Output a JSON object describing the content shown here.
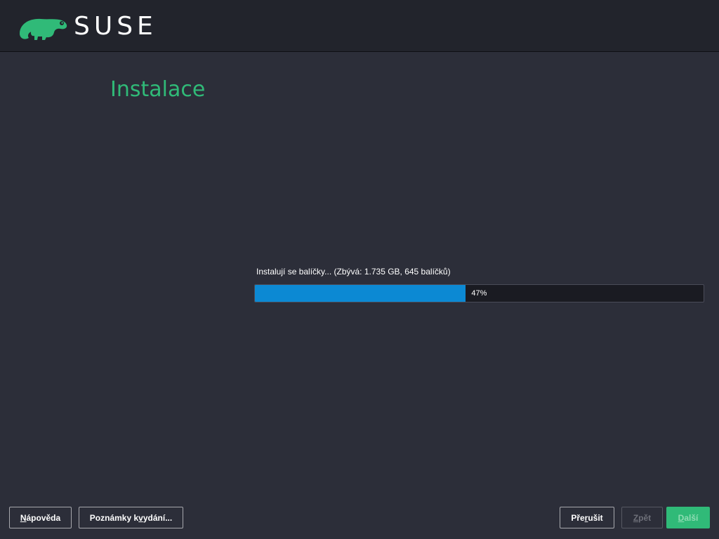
{
  "header": {
    "logo_text": "SUSE",
    "logo_icon": "suse-chameleon-icon",
    "brand_color": "#30ba78"
  },
  "main": {
    "title": "Instalace",
    "progress": {
      "label": "Instalují se balíčky... (Zbývá: 1.735 GB, 645 balíčků)",
      "text": "47%",
      "fraction": 0.47,
      "fill_color": "#0c89d3"
    }
  },
  "footer": {
    "help": {
      "prefix": "",
      "mnemonic": "N",
      "suffix": "ápověda"
    },
    "release_notes": {
      "prefix": "Poznámky k ",
      "mnemonic": "v",
      "suffix": "ydání..."
    },
    "abort": {
      "prefix": "Pře",
      "mnemonic": "r",
      "suffix": "ušit"
    },
    "back": {
      "prefix": "",
      "mnemonic": "Z",
      "suffix": "pět",
      "enabled": false
    },
    "next": {
      "prefix": "",
      "mnemonic": "D",
      "suffix": "alší",
      "enabled": false
    }
  }
}
